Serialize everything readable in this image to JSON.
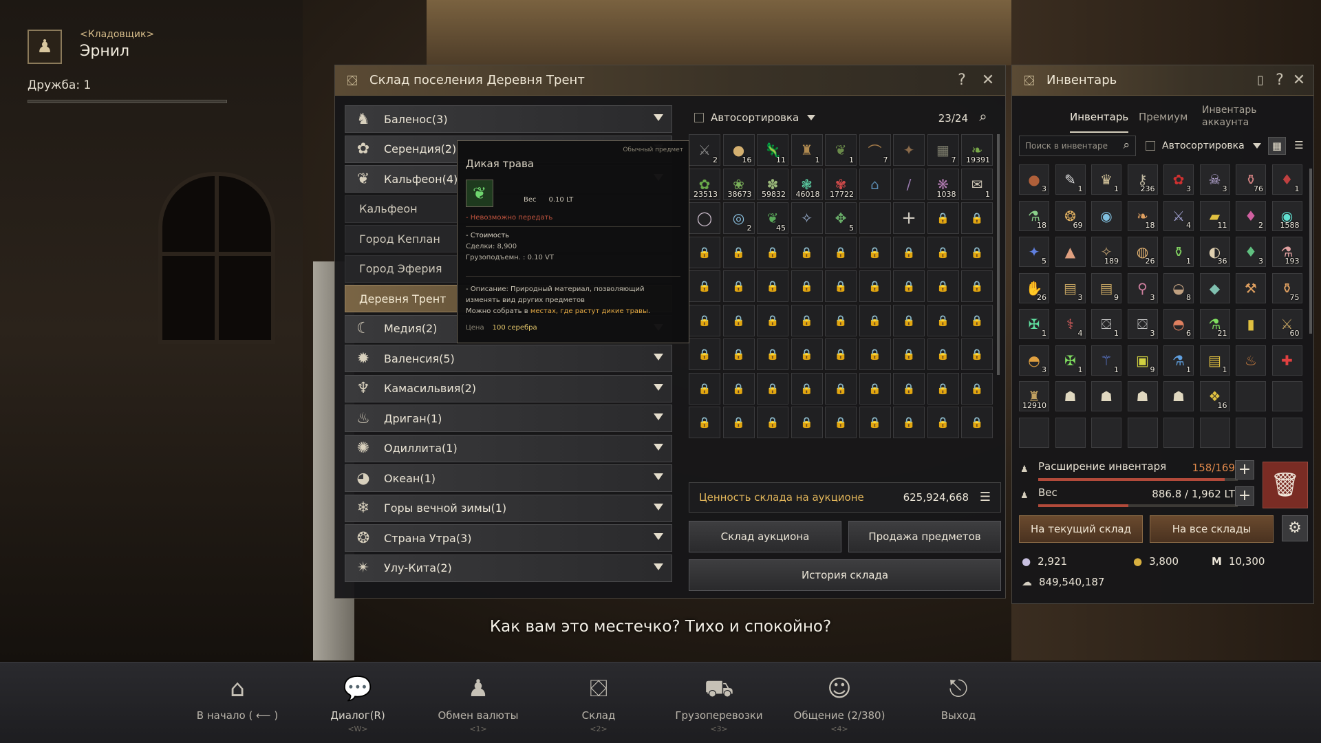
{
  "npc": {
    "role": "<Кладовщик>",
    "name": "Эрнил",
    "friendship": "Дружба: 1",
    "icon": "money-bag-icon"
  },
  "storage": {
    "title": "Склад поселения Деревня Трент",
    "regions": [
      {
        "label": "Баленос(3)",
        "icon": "horse-icon",
        "kind": "group"
      },
      {
        "label": "Серендия(2)",
        "icon": "flower-icon",
        "kind": "group"
      },
      {
        "label": "Кальфеон(4)",
        "icon": "wings-icon",
        "kind": "group"
      },
      {
        "label": "Кальфеон",
        "kind": "sub"
      },
      {
        "label": "Город Кеплан",
        "kind": "sub"
      },
      {
        "label": "Город Эферия",
        "kind": "sub"
      },
      {
        "label": "Деревня Трент",
        "kind": "active"
      },
      {
        "label": "Медия(2)",
        "icon": "moon-icon",
        "kind": "group"
      },
      {
        "label": "Валенсия(5)",
        "icon": "sun-icon",
        "kind": "group"
      },
      {
        "label": "Камасильвия(2)",
        "icon": "tree-icon",
        "kind": "group"
      },
      {
        "label": "Дриган(1)",
        "icon": "dragon-icon",
        "kind": "group"
      },
      {
        "label": "Одиллита(1)",
        "icon": "leaf-icon",
        "kind": "group"
      },
      {
        "label": "Океан(1)",
        "icon": "wave-icon",
        "kind": "group"
      },
      {
        "label": "Горы вечной зимы(1)",
        "icon": "snowflake-icon",
        "kind": "group"
      },
      {
        "label": "Страна Утра(3)",
        "icon": "mandala-icon",
        "kind": "group"
      },
      {
        "label": "Улу-Кита(2)",
        "icon": "star-icon",
        "kind": "group"
      }
    ],
    "autosort": "Автосортировка",
    "slot_count": "23/24",
    "items": [
      {
        "icon": "⚔",
        "count": "2",
        "color": "#8a8a8a"
      },
      {
        "icon": "●",
        "count": "16",
        "color": "#d4b070"
      },
      {
        "icon": "🦎",
        "count": "11",
        "color": "#a08060"
      },
      {
        "icon": "♜",
        "count": "1",
        "color": "#b08a50"
      },
      {
        "icon": "❦",
        "count": "1",
        "color": "#6a8a4a"
      },
      {
        "icon": "⌒",
        "count": "7",
        "color": "#a07848"
      },
      {
        "icon": "✦",
        "count": "",
        "color": "#8a6a4a"
      },
      {
        "icon": "▦",
        "count": "7",
        "color": "#7a7a6a"
      },
      {
        "icon": "❧",
        "count": "19391",
        "color": "#7aaa4a"
      },
      {
        "icon": "✿",
        "count": "23513",
        "color": "#6aaa4a"
      },
      {
        "icon": "❀",
        "count": "38673",
        "color": "#7ab05a"
      },
      {
        "icon": "✽",
        "count": "59832",
        "color": "#9ab87a"
      },
      {
        "icon": "❃",
        "count": "46018",
        "color": "#5acaa0"
      },
      {
        "icon": "✾",
        "count": "17722",
        "color": "#d04a4a"
      },
      {
        "icon": "⌂",
        "count": "",
        "color": "#5a8ab0"
      },
      {
        "icon": "/",
        "count": "",
        "color": "#9a7ab0"
      },
      {
        "icon": "❋",
        "count": "1038",
        "color": "#b07ab0"
      },
      {
        "icon": "✉",
        "count": "1",
        "color": "#c8c0b0"
      },
      {
        "icon": "◯",
        "count": "",
        "color": "#d0c0d0"
      },
      {
        "icon": "◎",
        "count": "2",
        "color": "#8ac0e0"
      },
      {
        "icon": "❦",
        "count": "45",
        "color": "#5aaa5a"
      },
      {
        "icon": "✧",
        "count": "",
        "color": "#9ab0d0"
      },
      {
        "icon": "✥",
        "count": "5",
        "color": "#6ab06a"
      }
    ],
    "auction_value_label": "Ценность склада на аукционе",
    "auction_value": "625,924,668",
    "btn_auction": "Склад аукциона",
    "btn_sell": "Продажа предметов",
    "btn_history": "История склада"
  },
  "tooltip": {
    "grade": "Обычный предмет",
    "name": "Дикая трава",
    "weight_label": "Вес",
    "weight_value": "0.10 LT",
    "no_trade": "- Невозможно передать",
    "price_head": "- Стоимость",
    "deal": "Сделки: 8,900",
    "cargo": "Грузоподъемн. : 0.10 VT",
    "desc1": "- Описание: Природный материал, позволяющий изменять вид других предметов",
    "desc2_a": "Можно собрать в ",
    "desc2_hl": "местах, где растут дикие травы",
    "desc2_b": ".",
    "cost_label": "Цена",
    "cost_value": "100 серебра"
  },
  "inventory": {
    "title": "Инвентарь",
    "tabs": [
      "Инвентарь",
      "Премиум",
      "Инвентарь аккаунта"
    ],
    "search_placeholder": "Поиск в инвентаре",
    "autosort": "Автосортировка",
    "items": [
      {
        "icon": "●",
        "count": "3",
        "color": "#b0603a"
      },
      {
        "icon": "✎",
        "count": "1",
        "color": "#e0e0e0"
      },
      {
        "icon": "♛",
        "count": "1",
        "color": "#d4c49a"
      },
      {
        "icon": "⚷",
        "count": "236",
        "color": "#c0b8a0"
      },
      {
        "icon": "✿",
        "count": "3",
        "color": "#d03030"
      },
      {
        "icon": "☠",
        "count": "3",
        "color": "#c0b0e0"
      },
      {
        "icon": "⚱",
        "count": "76",
        "color": "#d08080"
      },
      {
        "icon": "♦",
        "count": "1",
        "color": "#c04040"
      },
      {
        "icon": "⚗",
        "count": "18",
        "color": "#8ad08a"
      },
      {
        "icon": "❂",
        "count": "69",
        "color": "#e0b060"
      },
      {
        "icon": "◉",
        "count": "",
        "color": "#80c0e0"
      },
      {
        "icon": "❧",
        "count": "18",
        "color": "#e0a060"
      },
      {
        "icon": "⚔",
        "count": "4",
        "color": "#a0a0d0"
      },
      {
        "icon": "▰",
        "count": "11",
        "color": "#e0c040"
      },
      {
        "icon": "♦",
        "count": "2",
        "color": "#d060a0"
      },
      {
        "icon": "◉",
        "count": "1588",
        "color": "#60e0d0"
      },
      {
        "icon": "✦",
        "count": "5",
        "color": "#6080e0"
      },
      {
        "icon": "▲",
        "count": "",
        "color": "#e0a080"
      },
      {
        "icon": "✧",
        "count": "189",
        "color": "#c0a070"
      },
      {
        "icon": "◍",
        "count": "26",
        "color": "#e0b070"
      },
      {
        "icon": "⚱",
        "count": "1",
        "color": "#80d060"
      },
      {
        "icon": "◐",
        "count": "36",
        "color": "#e0d0b0"
      },
      {
        "icon": "♦",
        "count": "3",
        "color": "#60c080"
      },
      {
        "icon": "⚗",
        "count": "193",
        "color": "#e0a0a0"
      },
      {
        "icon": "✋",
        "count": "26",
        "color": "#a0a0a0"
      },
      {
        "icon": "▤",
        "count": "3",
        "color": "#c0a060"
      },
      {
        "icon": "▤",
        "count": "9",
        "color": "#c0a060"
      },
      {
        "icon": "⚲",
        "count": "3",
        "color": "#d080a0"
      },
      {
        "icon": "◒",
        "count": "8",
        "color": "#c0a080"
      },
      {
        "icon": "◆",
        "count": "",
        "color": "#80c0b0"
      },
      {
        "icon": "⚒",
        "count": "",
        "color": "#e0a060"
      },
      {
        "icon": "⚱",
        "count": "75",
        "color": "#e0a060"
      },
      {
        "icon": "✠",
        "count": "1",
        "color": "#60e0a0"
      },
      {
        "icon": "⚕",
        "count": "4",
        "color": "#e06060"
      },
      {
        "icon": "⛋",
        "count": "1",
        "color": "#c0c0c0"
      },
      {
        "icon": "⛋",
        "count": "3",
        "color": "#c0c0c0"
      },
      {
        "icon": "◓",
        "count": "6",
        "color": "#e08060"
      },
      {
        "icon": "⚗",
        "count": "21",
        "color": "#80e060"
      },
      {
        "icon": "▮",
        "count": "",
        "color": "#e0c040"
      },
      {
        "icon": "⚔",
        "count": "60",
        "color": "#c0a060"
      },
      {
        "icon": "◓",
        "count": "3",
        "color": "#e0a040"
      },
      {
        "icon": "✠",
        "count": "1",
        "color": "#80e060"
      },
      {
        "icon": "⚚",
        "count": "1",
        "color": "#6080e0"
      },
      {
        "icon": "▣",
        "count": "9",
        "color": "#d0d040"
      },
      {
        "icon": "⚗",
        "count": "1",
        "color": "#60a0e0"
      },
      {
        "icon": "▤",
        "count": "1",
        "color": "#e0c040"
      },
      {
        "icon": "♨",
        "count": "",
        "color": "#d08040"
      },
      {
        "icon": "✚",
        "count": "",
        "color": "#e04040"
      },
      {
        "icon": "♜",
        "count": "12910",
        "color": "#c0a060"
      },
      {
        "icon": "☗",
        "count": "",
        "color": "#e0d8c0"
      },
      {
        "icon": "☗",
        "count": "",
        "color": "#e0d8c0"
      },
      {
        "icon": "☗",
        "count": "",
        "color": "#e0d8c0"
      },
      {
        "icon": "☗",
        "count": "",
        "color": "#e0d8c0"
      },
      {
        "icon": "❖",
        "count": "16",
        "color": "#e0c040"
      }
    ],
    "expand_label": "Расширение инвентаря",
    "expand_value": "158/169",
    "expand_fill": 0.935,
    "weight_label": "Вес",
    "weight_value": "886.8 / 1,962 LT",
    "weight_fill": 0.452,
    "btn_current": "На текущий склад",
    "btn_all": "На все склады",
    "silver_small": "2,921",
    "gold_small": "3,800",
    "energy": "10,300",
    "silver": "849,540,187"
  },
  "dialog_text": "Как вам это местечко? Тихо и спокойно?",
  "bottom_menu": [
    {
      "label": "В начало ( ⟵ )",
      "key": "",
      "icon": "home-icon",
      "glyph": "⌂"
    },
    {
      "label": "Диалог(R)",
      "key": "<W>",
      "icon": "chat-bubble-icon",
      "glyph": "💬",
      "active": true
    },
    {
      "label": "Обмен валюты",
      "key": "<1>",
      "icon": "money-bag-icon",
      "glyph": "♟"
    },
    {
      "label": "Склад",
      "key": "<2>",
      "icon": "chest-icon",
      "glyph": "⛋"
    },
    {
      "label": "Грузоперевозки",
      "key": "<3>",
      "icon": "wagon-icon",
      "glyph": "⛟"
    },
    {
      "label": "Общение (2/380)",
      "key": "<4>",
      "icon": "social-icon",
      "glyph": "☺"
    },
    {
      "label": "Выход",
      "key": "",
      "icon": "exit-icon",
      "glyph": "⎋"
    }
  ]
}
